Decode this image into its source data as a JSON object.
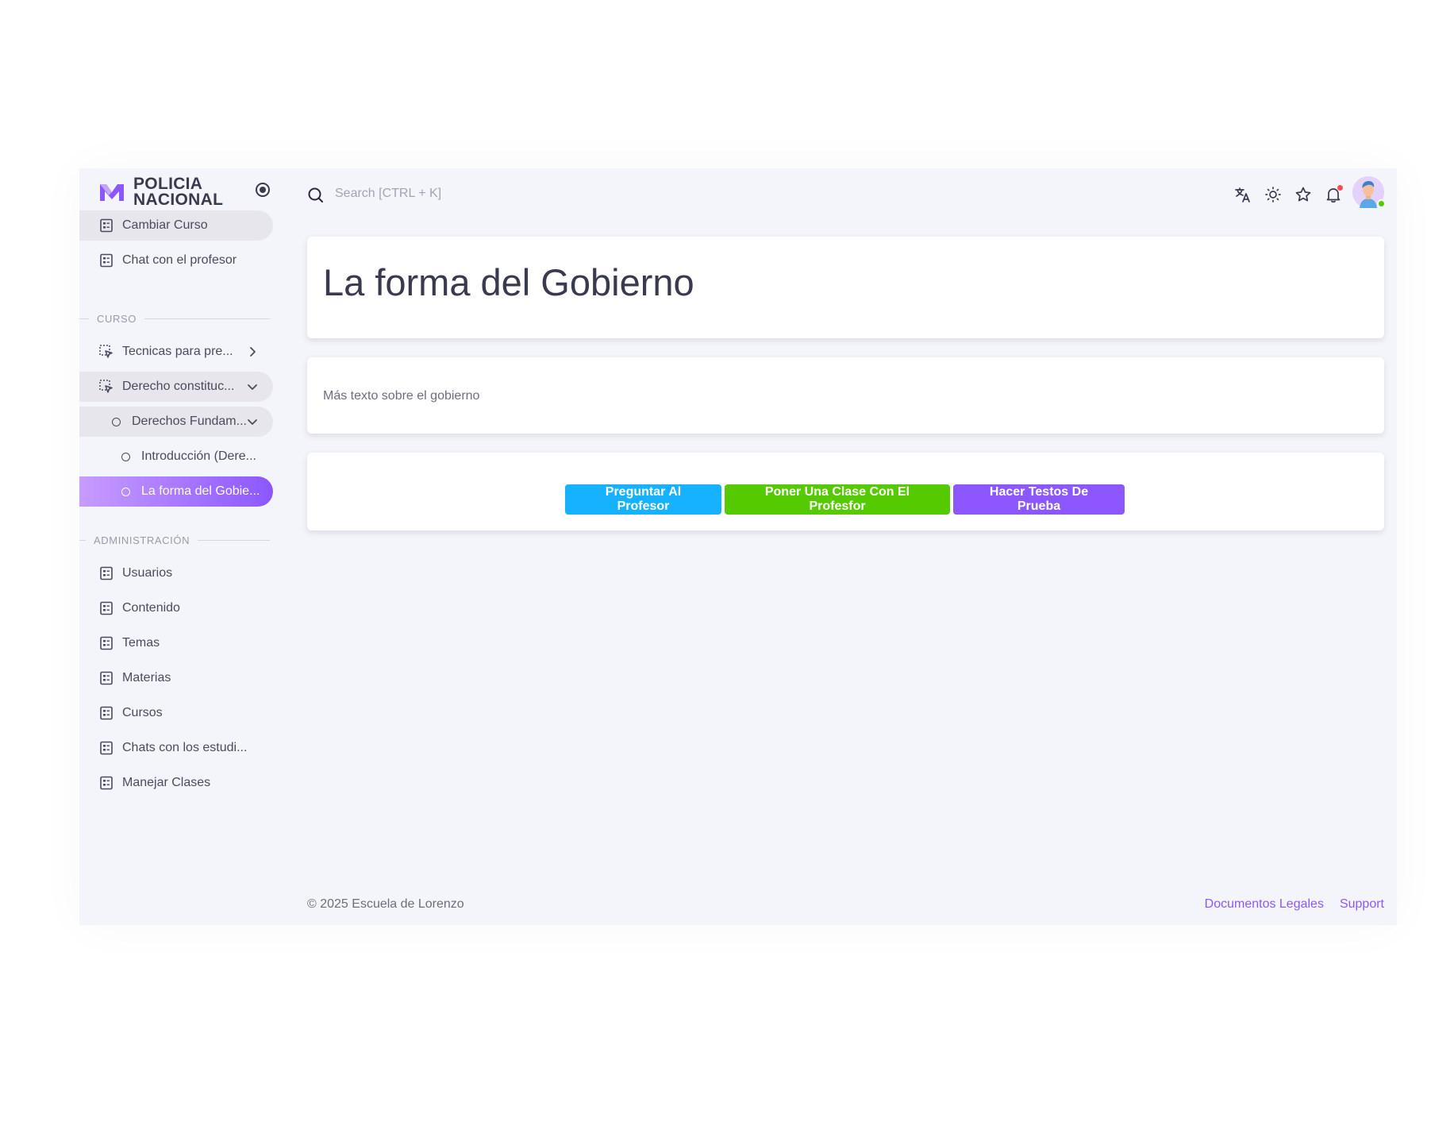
{
  "brand": {
    "line1": "POLICIA",
    "line2": "NACIONAL"
  },
  "sidebar": {
    "top_items": [
      {
        "label": "Cambiar Curso"
      },
      {
        "label": "Chat con el profesor"
      }
    ],
    "section_curso": "CURSO",
    "curso_items": [
      {
        "label": "Tecnicas para pre..."
      },
      {
        "label": "Derecho constituc..."
      },
      {
        "label": "Derechos Fundam..."
      },
      {
        "label": "Introducción (Dere..."
      },
      {
        "label": "La forma del Gobie..."
      }
    ],
    "section_admin": "ADMINISTRACIÓN",
    "admin_items": [
      {
        "label": "Usuarios"
      },
      {
        "label": "Contenido"
      },
      {
        "label": "Temas"
      },
      {
        "label": "Materias"
      },
      {
        "label": "Cursos"
      },
      {
        "label": "Chats con los estudi..."
      },
      {
        "label": "Manejar Clases"
      }
    ]
  },
  "header": {
    "search_placeholder": "Search [CTRL + K]"
  },
  "main": {
    "title": "La forma del Gobierno",
    "body": "Más texto sobre el gobierno",
    "buttons": {
      "ask": "Preguntar Al Profesor",
      "class": "Poner Una Clase Con El Profesfor",
      "tests": "Hacer Testos De Prueba"
    }
  },
  "footer": {
    "copyright": "© 2025 Escuela de Lorenzo",
    "legal": "Documentos Legales",
    "support": "Support"
  },
  "colors": {
    "primary": "#8c57ff",
    "info": "#16b1ff",
    "success": "#56ca00",
    "background": "#f4f5fa"
  }
}
